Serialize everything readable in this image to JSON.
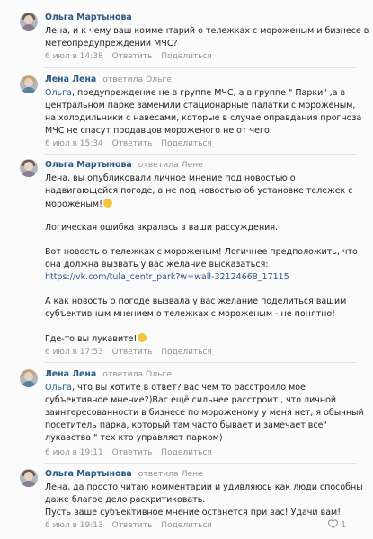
{
  "comments": [
    {
      "author": "Ольга Мартынова",
      "replied_to": "",
      "lines": [
        "Лена, и к чему ваш комментарий о тележках с мороженым и бизнесе в",
        "метеопредупреждении МЧС?"
      ],
      "date": "6 июл в 14:38",
      "reply_label": "Ответить",
      "share_label": "Поделиться"
    },
    {
      "author": "Лена Лена",
      "replied_to": "ответила Ольге",
      "mention": "Ольга",
      "lines": [
        ", предупреждение не в группе МЧС, а в группе \" Парки\" ,а в",
        "центральном парке заменили стационарные палатки с мороженым,",
        "на холодильники с навесами, которые в случае оправдания прогноза",
        "МЧС не спасут продавцов мороженого не от чего"
      ],
      "date": "6 июл в 15:34",
      "reply_label": "Ответить",
      "share_label": "Поделиться"
    },
    {
      "author": "Ольга Мартынова",
      "replied_to": "ответила Лене",
      "lines": [
        "Лена, вы опубликовали личное мнение под новостью о",
        "надвигающейся погоде, а не под новостью об установке тележек с",
        "мороженым!",
        "",
        "Логическая ошибка вкралась в ваши рассуждения.",
        "",
        "Вот новость о тележках с мороженым! Логичнее предположить, что",
        "она должна вызвать у вас желание высказаться:",
        "https://vk.com/tula_centr_park?w=wall-32124668_17115",
        "",
        "А как новость о погоде вызвала у вас желание поделиться вашим",
        "субъективным мнением о тележках с мороженым - не понятно!",
        "",
        "Где-то вы лукавите!"
      ],
      "date": "6 июл в 17:53",
      "reply_label": "Ответить",
      "share_label": "Поделиться"
    },
    {
      "author": "Лена Лена",
      "replied_to": "ответила Ольге",
      "mention": "Ольга",
      "lines": [
        ", что вы хотите в ответ? вас чем то расстроило мое",
        "субъективное мнение?)Вас ещё сильнее расстроит , что личной",
        "заинтересованности в бизнесе по мороженому у меня нет, я обычный",
        "посетитель парка, который там часто бывает и замечает все\"",
        "лукавства \" тех кто управляет парком)"
      ],
      "date": "6 июл в 19:11",
      "reply_label": "Ответить",
      "share_label": "Поделиться"
    },
    {
      "author": "Ольга Мартынова",
      "replied_to": "ответила Лене",
      "lines": [
        "Лена, да просто читаю комментарии и удивляюсь как люди способны",
        "даже благое дело раскритиковать.",
        "Пусть ваше субъективное мнение останется при вас! Удачи вам!"
      ],
      "date": "6 июл в 19:13",
      "reply_label": "Ответить",
      "share_label": "Поделиться",
      "likes": "1"
    }
  ],
  "colors": {
    "author": "#2a5885",
    "meta": "#939393",
    "text": "#222222",
    "divider": "#e1e3e6"
  },
  "icons": {
    "emoji": "smiling-face-emoji",
    "like": "heart-icon"
  }
}
